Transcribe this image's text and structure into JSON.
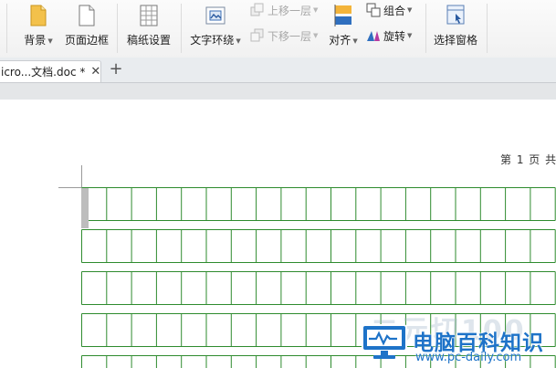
{
  "ribbon": {
    "background_label": "背景",
    "page_border_label": "页面边框",
    "manuscript_label": "稿纸设置",
    "text_wrap_label": "文字环绕",
    "bring_forward_label": "上移一层",
    "send_backward_label": "下移一层",
    "align_label": "对齐",
    "group_label": "组合",
    "rotate_label": "旋转",
    "selection_pane_label": "选择窗格"
  },
  "tabs": {
    "doc_title": "icro...文档.doc *",
    "close_glyph": "✕",
    "new_tab_glyph": "+"
  },
  "document": {
    "page_indicator": "第 1 页 共",
    "grid_color": "#2e8b2e"
  },
  "watermark": {
    "title": "电脑百科知识",
    "url": "www.pc-daily.com",
    "ghost_text": "二元切100"
  }
}
